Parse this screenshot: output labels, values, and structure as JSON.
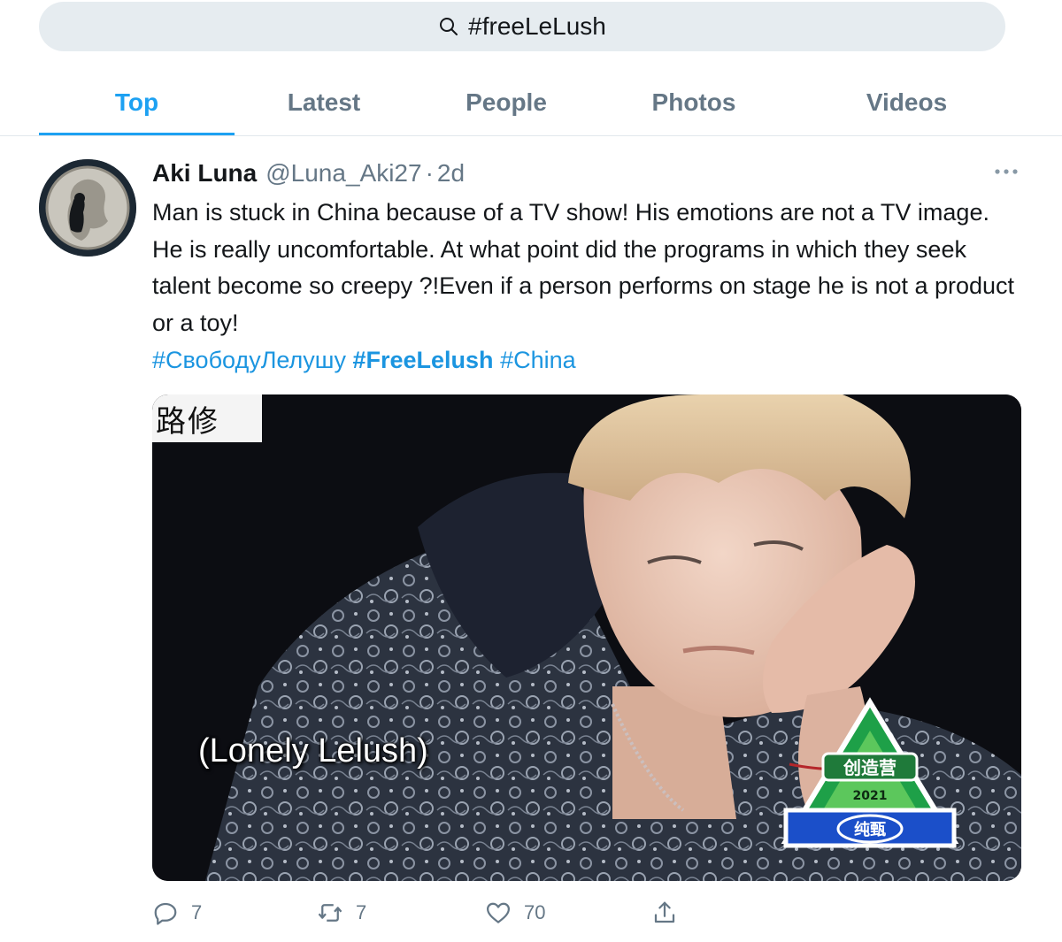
{
  "search": {
    "query": "#freeLeLush"
  },
  "tabs": [
    {
      "label": "Top",
      "active": true
    },
    {
      "label": "Latest"
    },
    {
      "label": "People"
    },
    {
      "label": "Photos"
    },
    {
      "label": "Videos"
    }
  ],
  "tweet": {
    "display_name": "Aki Luna",
    "handle": "@Luna_Aki27",
    "separator": "·",
    "time": "2d",
    "text": "Man is stuck in China because of a TV show! His emotions are not a TV image. He is really uncomfortable. At what point did the programs in which they seek talent become so creepy ?!Even if a person performs on stage he is not a product or a toy!",
    "hashtags": [
      {
        "text": "#СвободуЛелушу",
        "bold": false
      },
      {
        "text": "#FreeLelush",
        "bold": true
      },
      {
        "text": "#China",
        "bold": false
      }
    ],
    "media": {
      "watermark_text": "路修",
      "caption": "(Lonely Lelush)",
      "logo_text": "创造营",
      "logo_year": "2021",
      "logo_bottom_text": "纯甄"
    },
    "actions": {
      "replies": "7",
      "retweets": "7",
      "likes": "70"
    }
  },
  "colors": {
    "accent": "#1da1f2",
    "hashtag": "#1b95e0",
    "muted": "#657786",
    "search_bg": "#e6ecf0"
  },
  "icons": [
    "search-icon",
    "more-options-icon",
    "reply-icon",
    "retweet-icon",
    "like-icon",
    "share-icon"
  ]
}
